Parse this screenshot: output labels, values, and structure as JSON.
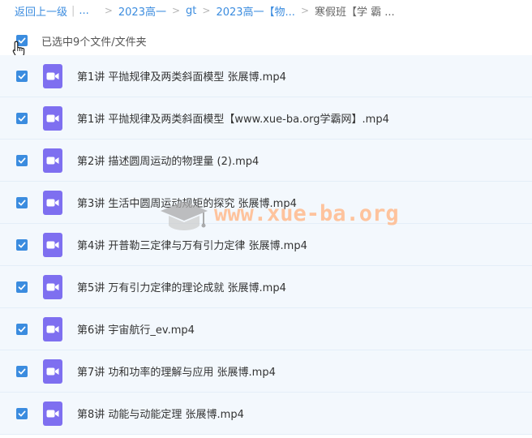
{
  "breadcrumb": {
    "back": "返回上一级",
    "ellipsis": "...",
    "items": [
      "2023高一",
      "gt",
      "2023高一【物..."
    ],
    "current": "寒假班【学 霸 ..."
  },
  "selection": {
    "text": "已选中9个文件/文件夹"
  },
  "files": [
    {
      "name": "第1讲 平抛规律及两类斜面模型 张展博.mp4"
    },
    {
      "name": "第1讲 平抛规律及两类斜面模型【www.xue-ba.org学霸网】.mp4"
    },
    {
      "name": "第2讲 描述圆周运动的物理量 (2).mp4"
    },
    {
      "name": "第3讲 生活中圆周运动规矩的探究 张展博.mp4"
    },
    {
      "name": "第4讲 开普勒三定律与万有引力定律 张展博.mp4"
    },
    {
      "name": "第5讲 万有引力定律的理论成就 张展博.mp4"
    },
    {
      "name": "第6讲 宇宙航行_ev.mp4"
    },
    {
      "name": "第7讲 功和功率的理解与应用 张展博.mp4"
    },
    {
      "name": "第8讲 动能与动能定理 张展博.mp4"
    }
  ],
  "watermark": {
    "text": "www.xue-ba.org"
  },
  "colors": {
    "accent": "#3b8cdf",
    "row_bg": "#f3f8fd",
    "video_icon": "#7e6ff0",
    "watermark": "#ffba8c"
  },
  "icons": {
    "checkbox": "check-icon",
    "file": "video-file-icon",
    "cursor": "hand-pointer-icon",
    "watermark": "graduation-cap-icon"
  }
}
